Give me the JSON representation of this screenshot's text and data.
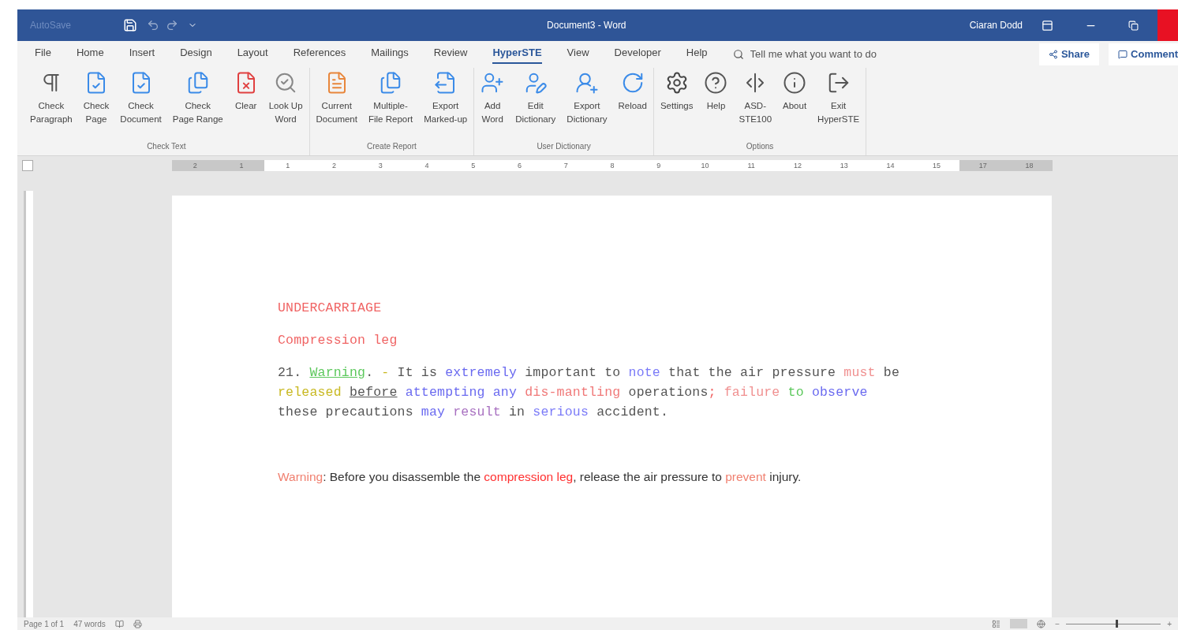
{
  "window": {
    "autosave": "AutoSave",
    "title": "Document3 - Word",
    "user": "Ciaran Dodd"
  },
  "menu_tabs": [
    {
      "label": "File",
      "selected": false
    },
    {
      "label": "Home",
      "selected": false
    },
    {
      "label": "Insert",
      "selected": false
    },
    {
      "label": "Design",
      "selected": false
    },
    {
      "label": "Layout",
      "selected": false
    },
    {
      "label": "References",
      "selected": false
    },
    {
      "label": "Mailings",
      "selected": false
    },
    {
      "label": "Review",
      "selected": false
    },
    {
      "label": "HyperSTE",
      "selected": true
    },
    {
      "label": "View",
      "selected": false
    },
    {
      "label": "Developer",
      "selected": false
    },
    {
      "label": "Help",
      "selected": false
    }
  ],
  "tell_me": {
    "placeholder": "Tell me what you want to do"
  },
  "share": "Share",
  "comments": "Comment",
  "ribbon_groups": [
    {
      "label": "Check Text",
      "buttons": [
        "Check\nParagraph",
        "Check\nPage",
        "Check\nDocument",
        "Check\nPage Range",
        "Clear",
        "Look Up\nWord"
      ]
    },
    {
      "label": "Create Report",
      "buttons": [
        "Current\nDocument",
        "Multiple-\nFile Report",
        "Export\nMarked-up"
      ]
    },
    {
      "label": "User Dictionary",
      "buttons": [
        "Add\nWord",
        "Edit\nDictionary",
        "Export\nDictionary",
        "Reload"
      ]
    },
    {
      "label": "Options",
      "buttons": [
        "Settings",
        "Help",
        "ASD-\nSTE100",
        "About",
        "Exit\nHyperSTE"
      ]
    }
  ],
  "ruler": [
    {
      "text": "2",
      "margin": true
    },
    {
      "text": "1",
      "margin": true
    },
    {
      "text": "1",
      "margin": false
    },
    {
      "text": "2",
      "margin": false
    },
    {
      "text": "3",
      "margin": false
    },
    {
      "text": "4",
      "margin": false
    },
    {
      "text": "5",
      "margin": false
    },
    {
      "text": "6",
      "margin": false
    },
    {
      "text": "7",
      "margin": false
    },
    {
      "text": "8",
      "margin": false
    },
    {
      "text": "9",
      "margin": false
    },
    {
      "text": "10",
      "margin": false
    },
    {
      "text": "11",
      "margin": false
    },
    {
      "text": "12",
      "margin": false
    },
    {
      "text": "13",
      "margin": false
    },
    {
      "text": "14",
      "margin": false
    },
    {
      "text": "15",
      "margin": false
    },
    {
      "text": "17",
      "margin": true
    },
    {
      "text": "18",
      "margin": true
    }
  ],
  "document": {
    "paragraphs": [
      {
        "kind": "mono",
        "runs": [
          {
            "text": "UNDERCARRIAGE",
            "color": "#f06464",
            "underlined": false
          }
        ]
      },
      {
        "kind": "mono",
        "runs": [
          {
            "text": "Compression leg",
            "color": "#f06464",
            "underlined": false
          }
        ]
      },
      {
        "kind": "mono",
        "runs": [
          {
            "text": "21. ",
            "underlined": false
          },
          {
            "text": "Warning",
            "color": "#5cc85c",
            "underlined": true
          },
          {
            "text": ".",
            "underlined": false
          },
          {
            "text": " - ",
            "color": "#c8b820",
            "underlined": false
          },
          {
            "text": "It is ",
            "underlined": false
          },
          {
            "text": "extremely",
            "color": "#6a6af0",
            "underlined": false
          },
          {
            "text": " important to ",
            "underlined": false
          },
          {
            "text": "note",
            "color": "#7a7af8",
            "underlined": false
          },
          {
            "text": " that the air pressure ",
            "underlined": false
          },
          {
            "text": "must",
            "color": "#f09090",
            "underlined": false
          },
          {
            "text": " be ",
            "underlined": false
          },
          {
            "text": "released ",
            "color": "#c8b820",
            "underlined": false
          },
          {
            "text": "before",
            "underlined": true
          },
          {
            "text": " attempting any ",
            "color": "#6a6af0",
            "underlined": false
          },
          {
            "text": "dis-mantling",
            "color": "#f07878",
            "underlined": false
          },
          {
            "text": " operations",
            "underlined": false
          },
          {
            "text": ";",
            "color": "#f06464",
            "underlined": false
          },
          {
            "text": " failure ",
            "color": "#f09090",
            "underlined": false
          },
          {
            "text": "to ",
            "color": "#5cc85c",
            "underlined": false
          },
          {
            "text": "observe",
            "color": "#6a6af0",
            "underlined": false
          },
          {
            "text": " these precautions ",
            "underlined": false
          },
          {
            "text": "may ",
            "color": "#6a6af0",
            "underlined": false
          },
          {
            "text": "result",
            "color": "#a870c0",
            "underlined": false
          },
          {
            "text": " in ",
            "underlined": false
          },
          {
            "text": "serious",
            "color": "#7a7af8",
            "underlined": false
          },
          {
            "text": " accident.",
            "underlined": false
          }
        ]
      },
      {
        "kind": "sans",
        "runs": [
          {
            "text": "Warning",
            "color": "#f08070",
            "underlined": false
          },
          {
            "text": ":  Before you disassemble the ",
            "color": "#333333",
            "underlined": false
          },
          {
            "text": "compression leg",
            "color": "#ff3030",
            "underlined": false
          },
          {
            "text": ", release the air pressure to ",
            "color": "#333333",
            "underlined": false
          },
          {
            "text": "prevent",
            "color": "#f08070",
            "underlined": false
          },
          {
            "text": " injury.",
            "color": "#333333",
            "underlined": false
          }
        ]
      }
    ]
  },
  "status_bar": {
    "page": "Page 1 of 1",
    "words": "47 words",
    "zoom_out": "−",
    "zoom_in": "+",
    "zoom": {
      "level": 0.52
    }
  }
}
